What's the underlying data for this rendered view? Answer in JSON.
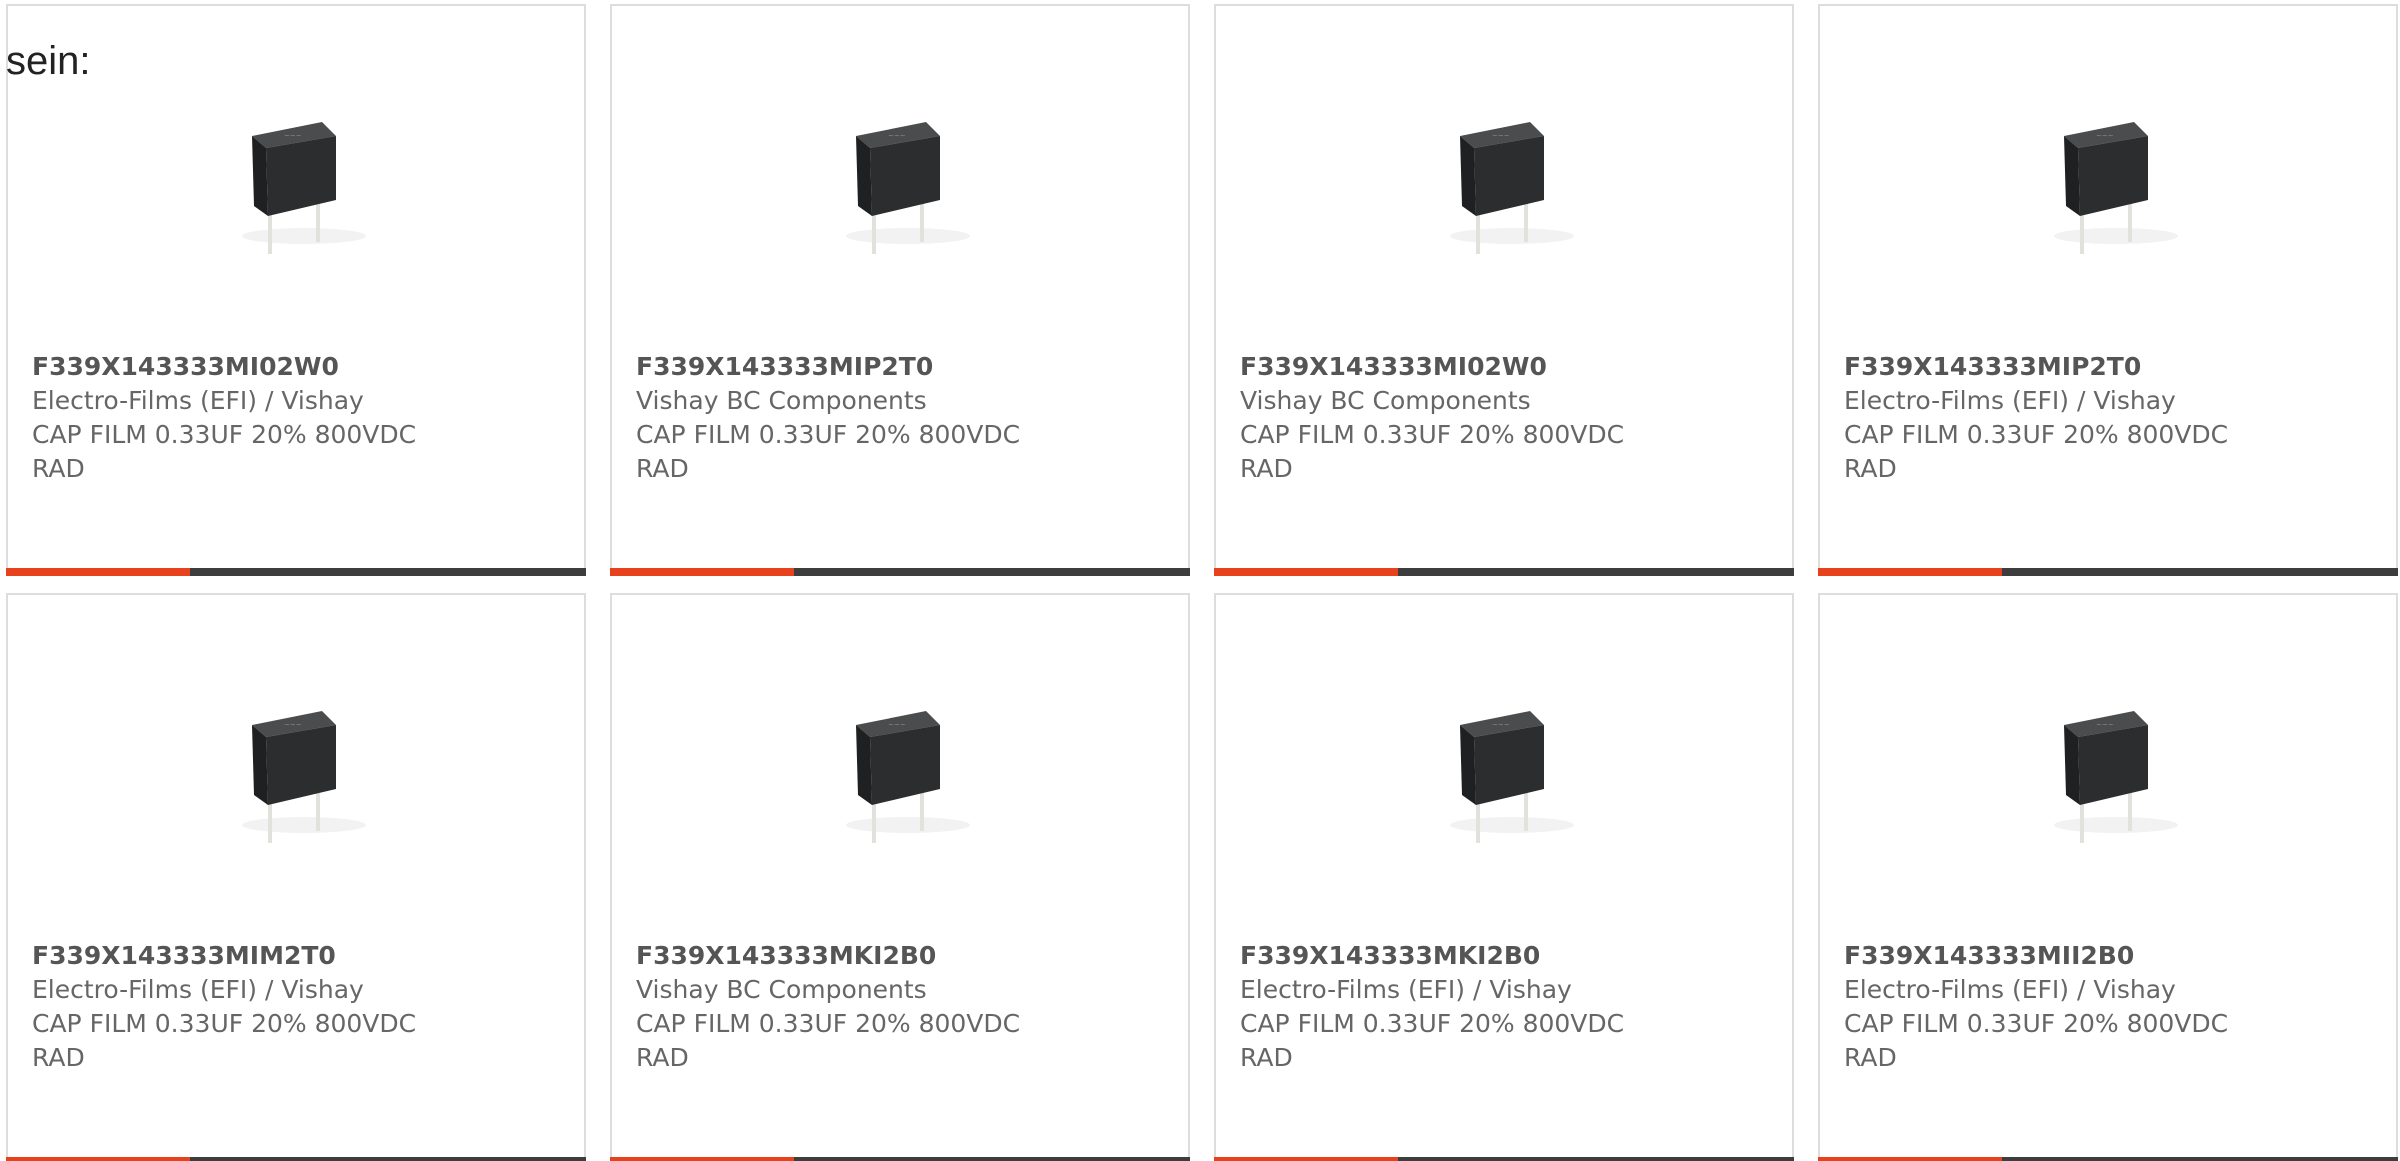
{
  "intro_text": "sein:",
  "colors": {
    "accent_bar": "#e8411e",
    "base_bar": "#3d3d3d",
    "border": "#dddddd",
    "text": "#666666"
  },
  "product_image_icon": "capacitor-image",
  "products": [
    {
      "part_number": "F339X143333MI02W0",
      "manufacturer": "Electro-Films (EFI) / Vishay",
      "description_line1": "CAP FILM 0.33UF 20% 800VDC",
      "description_line2": "RAD"
    },
    {
      "part_number": "F339X143333MIP2T0",
      "manufacturer": "Vishay BC Components",
      "description_line1": "CAP FILM 0.33UF 20% 800VDC",
      "description_line2": "RAD"
    },
    {
      "part_number": "F339X143333MI02W0",
      "manufacturer": "Vishay BC Components",
      "description_line1": "CAP FILM 0.33UF 20% 800VDC",
      "description_line2": "RAD"
    },
    {
      "part_number": "F339X143333MIP2T0",
      "manufacturer": "Electro-Films (EFI) / Vishay",
      "description_line1": "CAP FILM 0.33UF 20% 800VDC",
      "description_line2": "RAD"
    },
    {
      "part_number": "F339X143333MIM2T0",
      "manufacturer": "Electro-Films (EFI) / Vishay",
      "description_line1": "CAP FILM 0.33UF 20% 800VDC",
      "description_line2": "RAD"
    },
    {
      "part_number": "F339X143333MKI2B0",
      "manufacturer": "Vishay BC Components",
      "description_line1": "CAP FILM 0.33UF 20% 800VDC",
      "description_line2": "RAD"
    },
    {
      "part_number": "F339X143333MKI2B0",
      "manufacturer": "Electro-Films (EFI) / Vishay",
      "description_line1": "CAP FILM 0.33UF 20% 800VDC",
      "description_line2": "RAD"
    },
    {
      "part_number": "F339X143333MII2B0",
      "manufacturer": "Electro-Films (EFI) / Vishay",
      "description_line1": "CAP FILM 0.33UF 20% 800VDC",
      "description_line2": "RAD"
    }
  ]
}
